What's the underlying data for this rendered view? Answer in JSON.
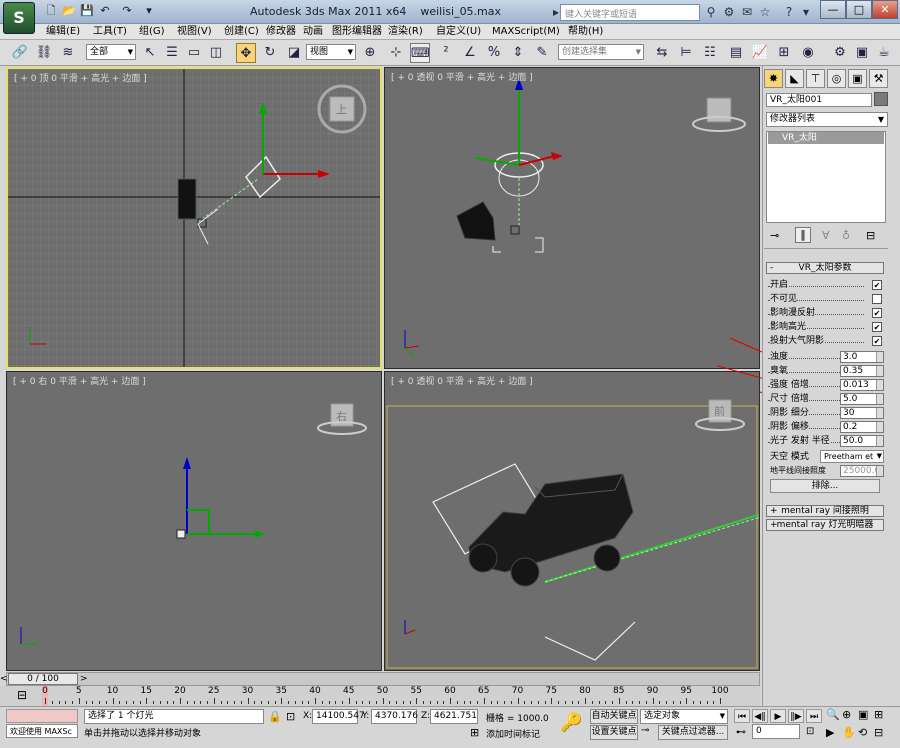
{
  "app": {
    "logo_letter": "S",
    "title": "Autodesk 3ds Max  2011 x64",
    "filename": "weilisi_05.max",
    "search_placeholder": "键入关键字或短语",
    "window_buttons": [
      "—",
      "□",
      "✕"
    ]
  },
  "menu": [
    "编辑(E)",
    "工具(T)",
    "组(G)",
    "视图(V)",
    "创建(C)",
    "修改器",
    "动画",
    "图形编辑器",
    "渲染(R)",
    "自定义(U)",
    "MAXScript(M)",
    "帮助(H)"
  ],
  "toolbar": {
    "filter_value": "全部",
    "ref_coord_value": "视图",
    "selection_set_placeholder": "创建选择集"
  },
  "viewports": {
    "top": {
      "label": "[ + 0 顶 0 平滑 + 高光 + 边面 ]",
      "cube_face": "上"
    },
    "perspective": {
      "label": "[ + 0 透视 0 平滑 + 高光 + 边面 ]"
    },
    "right": {
      "label": "[ + 0 右 0 平滑 + 高光 + 边面 ]",
      "cube_face": "右"
    },
    "camera": {
      "label": "[ + 0 透视 0 平滑 + 高光 + 边面 ]",
      "cube_face": "前"
    }
  },
  "command_panel": {
    "object_name": "VR_太阳001",
    "modifier_list_label": "修改器列表",
    "modifier_stack_item": "VR_太阳",
    "rollout_title": "VR_太阳参数",
    "checks": [
      {
        "label": "开启",
        "checked": true
      },
      {
        "label": "不可见",
        "checked": false
      },
      {
        "label": "影响漫反射",
        "checked": true
      },
      {
        "label": "影响高光",
        "checked": true
      },
      {
        "label": "投射大气阴影",
        "checked": true
      }
    ],
    "params": [
      {
        "label": "浊度",
        "value": "3.0"
      },
      {
        "label": "臭氧",
        "value": "0.35"
      },
      {
        "label": "强度 倍增",
        "value": "0.013"
      },
      {
        "label": "尺寸 倍增",
        "value": "5.0"
      },
      {
        "label": "阴影 细分",
        "value": "30"
      },
      {
        "label": "阴影 偏移",
        "value": "0.2"
      },
      {
        "label": "光子 发射 半径",
        "value": "50.0"
      }
    ],
    "sky_model_label": "天空 模式",
    "sky_model_value": "Preetham et",
    "horizon_label": "地平线间接照度",
    "horizon_value": "25000.0",
    "exclude_button": "排除...",
    "rollup_mr_indirect": "mental ray 间接照明",
    "rollup_mr_shader": "mental ray 灯光明暗器",
    "accent_color": "#ffffff"
  },
  "timeline": {
    "frame_display": "0 / 100",
    "ticks": [
      "0",
      "5",
      "10",
      "15",
      "20",
      "25",
      "30",
      "35",
      "40",
      "45",
      "50",
      "55",
      "60",
      "65",
      "70",
      "75",
      "80",
      "85",
      "90",
      "95",
      "100"
    ]
  },
  "status": {
    "maxscript_label": "欢迎使用 MAXSc",
    "selection_info": "选择了 1 个灯光",
    "prompt": "单击并拖动以选择并移动对象",
    "x_label": "X:",
    "x_value": "14100.547",
    "y_label": "Y:",
    "y_value": "4370.176",
    "z_label": "Z:",
    "z_value": "4621.751",
    "grid": "栅格 = 1000.0",
    "add_time_tag": "添加时间标记",
    "autokey": "自动关键点",
    "selected_object": "选定对象",
    "set_key": "设置关键点",
    "key_filters": "关键点过滤器...",
    "frame_value": "0"
  }
}
